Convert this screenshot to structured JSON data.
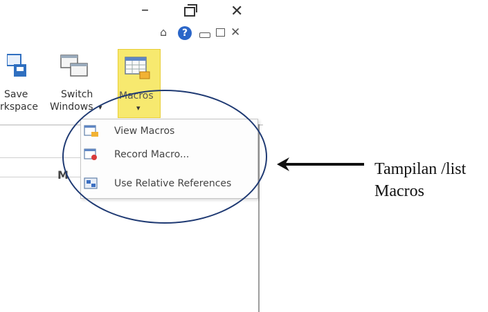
{
  "window": {
    "minimize_glyph": "–",
    "close_glyph": "✕"
  },
  "ribbon": {
    "save_workspace_label_line1": "Save",
    "save_workspace_label_line2": "rkspace",
    "switch_windows_label_line1": "Switch",
    "switch_windows_label_line2": "Windows",
    "switch_windows_dropdown": "▾",
    "macros_label": "Macros",
    "macros_dropdown": "▾",
    "help_glyph": "?",
    "collapse_glyph": "⌂",
    "mini_close_glyph": "✕"
  },
  "sheet": {
    "column_letter": "M"
  },
  "macros_menu": {
    "items": [
      {
        "label": "View Macros",
        "icon": "view-macros-icon"
      },
      {
        "label": "Record Macro...",
        "icon": "record-macro-icon"
      },
      {
        "label": "Use Relative References",
        "icon": "relative-references-icon"
      }
    ]
  },
  "annotation": {
    "line1": "Tampilan /list",
    "line2": "Macros"
  },
  "colors": {
    "oval": "#1f3a73",
    "macros_highlight": "#f7e96f",
    "help_blue": "#2b66c8"
  }
}
